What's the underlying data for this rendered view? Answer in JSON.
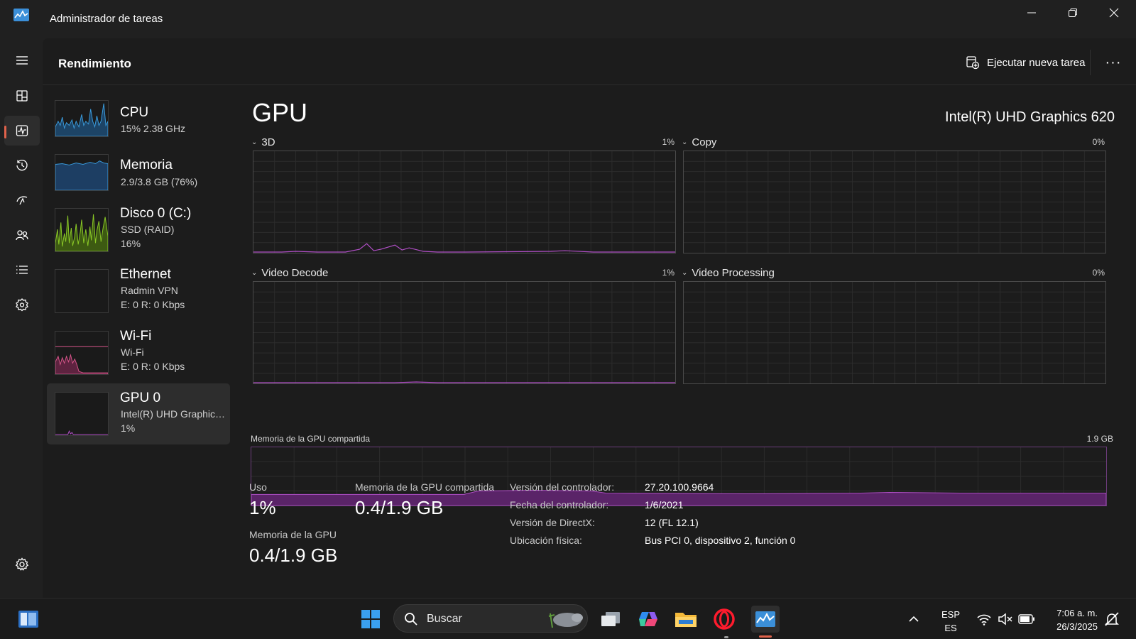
{
  "window": {
    "title": "Administrador de tareas",
    "icons": [
      "task-manager-icon",
      "minimize-icon",
      "restore-icon",
      "close-icon"
    ]
  },
  "header": {
    "page_title": "Rendimiento",
    "run_task_label": "Ejecutar nueva tarea",
    "more_label": "···"
  },
  "rail": {
    "items": [
      "menu-icon",
      "processes-icon",
      "performance-icon",
      "app-history-icon",
      "startup-icon",
      "users-icon",
      "details-icon",
      "services-icon"
    ],
    "settings": "settings-icon"
  },
  "devices": [
    {
      "name": "CPU",
      "line1": "15%  2.38 GHz",
      "line2": "",
      "color": "#3a9bdc"
    },
    {
      "name": "Memoria",
      "line1": "2.9/3.8 GB (76%)",
      "line2": "",
      "color": "#3a9bdc"
    },
    {
      "name": "Disco 0 (C:)",
      "line1": "SSD (RAID)",
      "line2": "16%",
      "color": "#8ac926"
    },
    {
      "name": "Ethernet",
      "line1": "Radmin VPN",
      "line2": "E: 0  R: 0 Kbps",
      "color": "#b2577e"
    },
    {
      "name": "Wi-Fi",
      "line1": "Wi-Fi",
      "line2": "E: 0  R: 0 Kbps",
      "color": "#d6558a"
    },
    {
      "name": "GPU 0",
      "line1": "Intel(R) UHD Graphics 620",
      "line2": "1%",
      "color": "#b04fc6"
    }
  ],
  "detail": {
    "title": "GPU",
    "model": "Intel(R) UHD Graphics 620",
    "engines": [
      {
        "label": "3D",
        "percent": "1%"
      },
      {
        "label": "Copy",
        "percent": "0%"
      },
      {
        "label": "Video Decode",
        "percent": "1%"
      },
      {
        "label": "Video Processing",
        "percent": "0%"
      }
    ],
    "shared_memory_label": "Memoria de la GPU compartida",
    "shared_memory_max": "1.9 GB",
    "stats": {
      "usage_label": "Uso",
      "usage_value": "1%",
      "shared_label": "Memoria de la GPU compartida",
      "shared_value": "0.4/1.9 GB",
      "gpu_mem_label": "Memoria de la GPU",
      "gpu_mem_value": "0.4/1.9 GB"
    },
    "info": [
      {
        "key": "Versión del controlador:",
        "value": "27.20.100.9664"
      },
      {
        "key": "Fecha del controlador:",
        "value": "1/6/2021"
      },
      {
        "key": "Versión de DirectX:",
        "value": "12 (FL 12.1)"
      },
      {
        "key": "Ubicación física:",
        "value": "Bus PCI 0, dispositivo 2, función 0"
      }
    ],
    "accent_color": "#b04fc6"
  },
  "taskbar": {
    "search_placeholder": "Buscar",
    "lang_top": "ESP",
    "lang_bottom": "ES",
    "time": "7:06 a. m.",
    "date": "26/3/2025",
    "icons": [
      "widgets-icon",
      "start-icon",
      "search-icon",
      "task-view-icon",
      "copilot-icon",
      "file-explorer-icon",
      "opera-icon",
      "task-manager-icon",
      "chevron-up-icon",
      "wifi-icon",
      "volume-muted-icon",
      "battery-icon",
      "notification-icon"
    ]
  }
}
